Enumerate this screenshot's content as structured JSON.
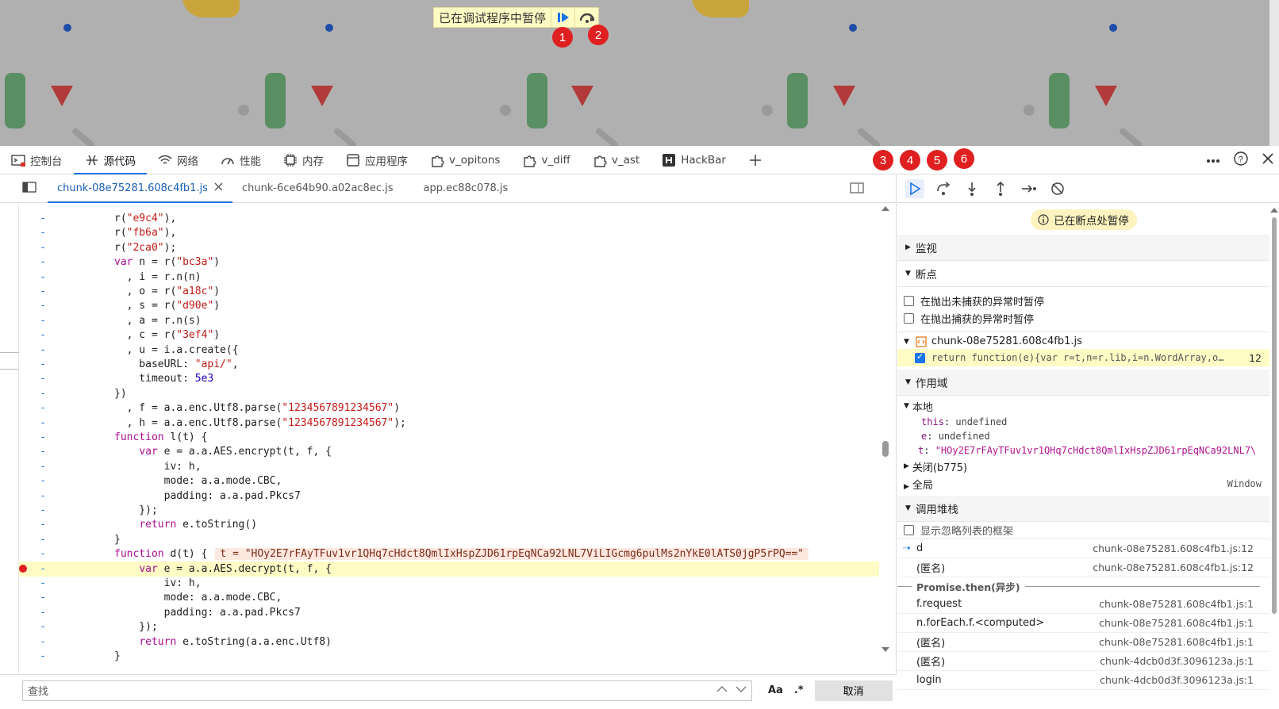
{
  "viewport": {
    "paused_text": "已在调试程序中暂停",
    "badges": [
      "1",
      "2",
      "3",
      "4",
      "5",
      "6"
    ]
  },
  "devtools_tabs": [
    {
      "label": "控制台",
      "icon": "console-icon"
    },
    {
      "label": "源代码",
      "icon": "sources-icon",
      "active": true
    },
    {
      "label": "网络",
      "icon": "wifi-icon"
    },
    {
      "label": "性能",
      "icon": "gauge-icon"
    },
    {
      "label": "内存",
      "icon": "chip-icon"
    },
    {
      "label": "应用程序",
      "icon": "app-icon"
    },
    {
      "label": "v_opitons",
      "icon": "puzzle-icon"
    },
    {
      "label": "v_diff",
      "icon": "puzzle-icon"
    },
    {
      "label": "v_ast",
      "icon": "puzzle-icon"
    },
    {
      "label": "HackBar",
      "icon": "hackbar-icon"
    }
  ],
  "file_tabs": [
    {
      "label": "chunk-08e75281.608c4fb1.js",
      "active": true
    },
    {
      "label": "chunk-6ce64b90.a02ac8ec.js"
    },
    {
      "label": "app.ec88c078.js"
    }
  ],
  "code": [
    {
      "text": "r(\"e9c4\"),",
      "indent": 2
    },
    {
      "text": "r(\"fb6a\"),",
      "indent": 2
    },
    {
      "text": "r(\"2ca0\");",
      "indent": 2
    },
    {
      "text": "var n = r(\"bc3a\")",
      "indent": 2
    },
    {
      "text": "  , i = r.n(n)",
      "indent": 2
    },
    {
      "text": "  , o = r(\"a18c\")",
      "indent": 2
    },
    {
      "text": "  , s = r(\"d90e\")",
      "indent": 2
    },
    {
      "text": "  , a = r.n(s)",
      "indent": 2
    },
    {
      "text": "  , c = r(\"3ef4\")",
      "indent": 2
    },
    {
      "text": "  , u = i.a.create({",
      "indent": 2
    },
    {
      "text": "    baseURL: \"api/\",",
      "indent": 2
    },
    {
      "text": "    timeout: 5e3",
      "indent": 2
    },
    {
      "text": "})",
      "indent": 2
    },
    {
      "text": "  , f = a.a.enc.Utf8.parse(\"1234567891234567\")",
      "indent": 2
    },
    {
      "text": "  , h = a.a.enc.Utf8.parse(\"1234567891234567\");",
      "indent": 2
    },
    {
      "text": "function l(t) {",
      "indent": 2
    },
    {
      "text": "    var e = a.a.AES.encrypt(t, f, {",
      "indent": 2
    },
    {
      "text": "        iv: h,",
      "indent": 2
    },
    {
      "text": "        mode: a.a.mode.CBC,",
      "indent": 2
    },
    {
      "text": "        padding: a.a.pad.Pkcs7",
      "indent": 2
    },
    {
      "text": "    });",
      "indent": 2
    },
    {
      "text": "    return e.toString()",
      "indent": 2
    },
    {
      "text": "}",
      "indent": 2
    },
    {
      "text": "function d(t) {",
      "indent": 2,
      "inline": "t = \"HOy2E7rFAyTFuv1vr1QHq7cHdct8QmlIxHspZJD61rpEqNCa92LNL7ViLIGcmg6pulMs2nYkE0lATS0jgP5rPQ==\""
    },
    {
      "text": "    var e = a.a.AES.decrypt(t, f, {",
      "indent": 2,
      "highlight": true,
      "breakpoint": true
    },
    {
      "text": "        iv: h,",
      "indent": 2
    },
    {
      "text": "        mode: a.a.mode.CBC,",
      "indent": 2
    },
    {
      "text": "        padding: a.a.pad.Pkcs7",
      "indent": 2
    },
    {
      "text": "    });",
      "indent": 2
    },
    {
      "text": "    return e.toString(a.a.enc.Utf8)",
      "indent": 2
    },
    {
      "text": "}",
      "indent": 2
    }
  ],
  "find": {
    "placeholder": "查找",
    "match_case": "Aa",
    "regex": ".*",
    "cancel": "取消"
  },
  "debugger": {
    "paused_pill": "已在断点处暂停",
    "watch": "监视",
    "breakpoints": "断点",
    "pause_uncaught": "在抛出未捕获的异常时暂停",
    "pause_caught": "在抛出捕获的异常时暂停",
    "bp_file": "chunk-08e75281.608c4fb1.js",
    "bp_code": "return function(e){var r=t,n=r.lib,i=n.WordArray,o…",
    "bp_line": "12",
    "scope": "作用域",
    "local": "本地",
    "this_key": "this",
    "this_val": "undefined",
    "e_key": "e",
    "e_val": "undefined",
    "t_key": "t",
    "t_val": "\"HOy2E7rFAyTFuv1vr1QHq7cHdct8QmlIxHspZJD61rpEqNCa92LNL7\\",
    "closure": "关闭(b775)",
    "global": "全局",
    "global_val": "Window",
    "call_stack": "调用堆栈",
    "show_ignored": "显示忽略列表的框架",
    "stack": [
      {
        "name": "d",
        "loc": "chunk-08e75281.608c4fb1.js:12",
        "current": true
      },
      {
        "name": "(匿名)",
        "loc": "chunk-08e75281.608c4fb1.js:12"
      }
    ],
    "async_label": "Promise.then(异步)",
    "stack_async": [
      {
        "name": "f.request",
        "loc": "chunk-08e75281.608c4fb1.js:1"
      },
      {
        "name": "n.forEach.f.<computed>",
        "loc": "chunk-08e75281.608c4fb1.js:1"
      },
      {
        "name": "(匿名)",
        "loc": "chunk-08e75281.608c4fb1.js:1"
      },
      {
        "name": "(匿名)",
        "loc": "chunk-4dcb0d3f.3096123a.js:1"
      },
      {
        "name": "login",
        "loc": "chunk-4dcb0d3f.3096123a.js:1"
      }
    ]
  },
  "colors": {
    "badge": "#e02020",
    "accent": "#1a73e8",
    "paused_bg": "#fffbc4"
  }
}
